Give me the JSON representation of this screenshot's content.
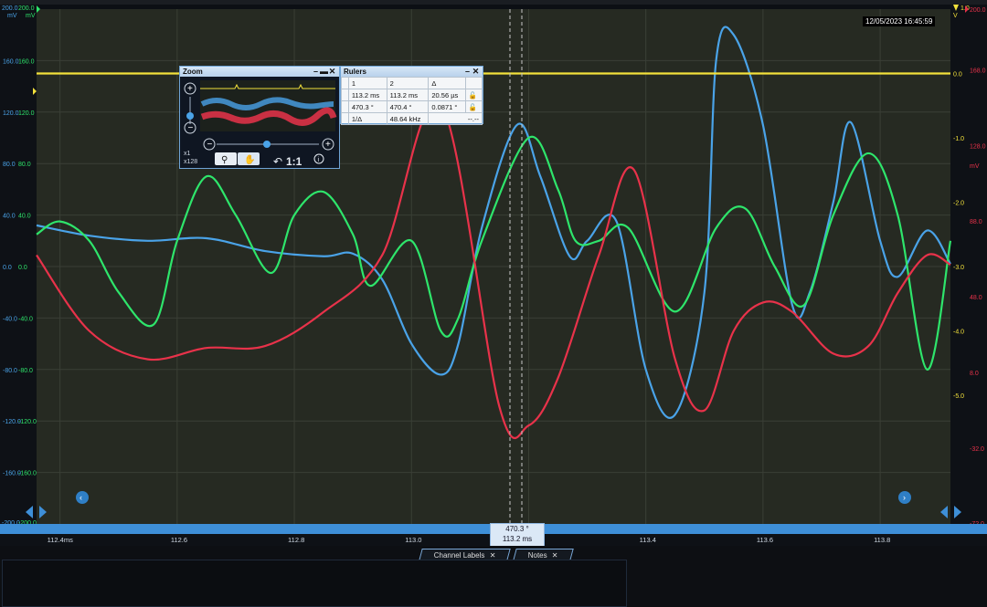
{
  "timestamp": "12/05/2023 16:45:59",
  "colors": {
    "blue": "#4aa3e8",
    "green": "#2ee56b",
    "red": "#e8324a",
    "yellow": "#f2e13b",
    "plot_bg": "#262a22",
    "axisbar": "#3e8fd8"
  },
  "left_axis": {
    "unit_blue": "mV",
    "unit_green": "mV",
    "top_blue": "200.0",
    "top_green": "200.0",
    "ticks": [
      "160.0",
      "120.0",
      "80.0",
      "40.0",
      "0.0",
      "-40.0",
      "-80.0",
      "-120.0",
      "-160.0"
    ],
    "bottom_blue": "-200.0",
    "bottom_green": "-200.0"
  },
  "right_axis_yellow": {
    "top": "1.0",
    "unit": "V",
    "ticks": [
      "0.0",
      "-1.0",
      "-2.0",
      "-3.0",
      "-4.0",
      "-5.0"
    ]
  },
  "right_axis_red": {
    "unit": "mV",
    "ticks": [
      "200.0",
      "168.0",
      "128.0",
      "88.0",
      "48.0",
      "8.0",
      "-32.0",
      "-72.0"
    ]
  },
  "x_axis": {
    "ticks": [
      "112.4ms",
      "112.6",
      "112.8",
      "113.0",
      "113.2",
      "113.4",
      "113.6",
      "113.8"
    ]
  },
  "zoom": {
    "title": "Zoom",
    "factor1": "x1",
    "factor2": "x128",
    "ratio": "1:1"
  },
  "rulers": {
    "title": "Rulers",
    "header": [
      "",
      "1",
      "2",
      "Δ",
      ""
    ],
    "row1": [
      "",
      "113.2 ms",
      "113.2 ms",
      "20.56 µs",
      "lock"
    ],
    "row2": [
      "",
      "470.3 °",
      "470.4 °",
      "0.0871 °",
      "lock"
    ],
    "freq_label": "1/Δ",
    "freq_value": "48.64 kHz",
    "freq_extra": "--.--"
  },
  "cursor_readout": {
    "angle": "470.3 °",
    "time": "113.2 ms"
  },
  "tabs": [
    {
      "label": "Channel Labels"
    },
    {
      "label": "Notes"
    }
  ],
  "chart_data": {
    "type": "line",
    "x_unit": "ms",
    "xlim": [
      112.36,
      113.92
    ],
    "series": [
      {
        "color": "blue",
        "axis": "mV (left)",
        "x": [
          112.36,
          112.45,
          112.55,
          112.65,
          112.75,
          112.85,
          112.9,
          112.95,
          113.0,
          113.05,
          113.08,
          113.12,
          113.18,
          113.22,
          113.27,
          113.3,
          113.35,
          113.4,
          113.45,
          113.5,
          113.52,
          113.55,
          113.6,
          113.65,
          113.68,
          113.72,
          113.75,
          113.8,
          113.83,
          113.88,
          113.92
        ],
        "values": [
          32,
          24,
          20,
          22,
          12,
          8,
          10,
          -10,
          -60,
          -84,
          -60,
          30,
          110,
          70,
          8,
          20,
          35,
          -80,
          -115,
          -20,
          160,
          180,
          110,
          -30,
          -20,
          50,
          112,
          20,
          -8,
          28,
          2
        ]
      },
      {
        "color": "green",
        "axis": "mV (left)",
        "x": [
          112.36,
          112.4,
          112.45,
          112.5,
          112.56,
          112.6,
          112.65,
          112.7,
          112.76,
          112.8,
          112.85,
          112.9,
          112.93,
          113.0,
          113.05,
          113.08,
          113.12,
          113.2,
          113.25,
          113.28,
          113.32,
          113.37,
          113.45,
          113.52,
          113.57,
          113.62,
          113.67,
          113.72,
          113.78,
          113.83,
          113.88,
          113.92
        ],
        "values": [
          25,
          35,
          20,
          -20,
          -45,
          20,
          70,
          40,
          -5,
          40,
          58,
          25,
          -15,
          20,
          -50,
          -40,
          20,
          100,
          60,
          20,
          20,
          30,
          -35,
          30,
          45,
          0,
          -30,
          40,
          88,
          40,
          -80,
          20
        ]
      },
      {
        "color": "red",
        "axis": "mV (right)",
        "x": [
          112.36,
          112.45,
          112.55,
          112.65,
          112.75,
          112.85,
          112.95,
          113.05,
          113.15,
          113.2,
          113.25,
          113.32,
          113.38,
          113.45,
          113.5,
          113.55,
          113.6,
          113.65,
          113.72,
          113.78,
          113.83,
          113.88,
          113.92
        ],
        "values": [
          70,
          30,
          15,
          21,
          22,
          40,
          70,
          150,
          -10,
          -20,
          5,
          70,
          115,
          15,
          -12,
          30,
          45,
          40,
          18,
          22,
          50,
          70,
          65
        ]
      },
      {
        "color": "yellow",
        "axis": "V (right)",
        "x": [
          112.36,
          113.92
        ],
        "values": [
          0.0,
          0.0
        ]
      }
    ]
  }
}
